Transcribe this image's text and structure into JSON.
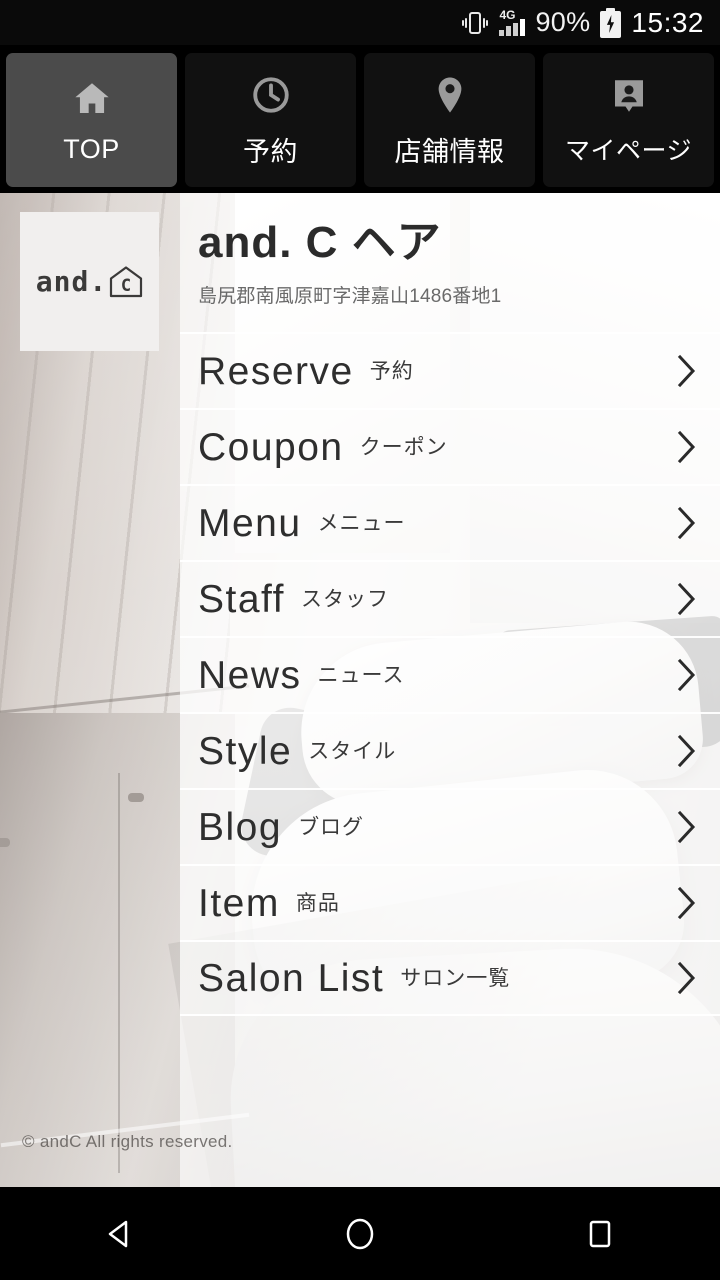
{
  "status_bar": {
    "vibrate_icon": "vibrate-icon",
    "network_type": "4G",
    "signal_icon": "signal-bars-icon",
    "battery_percent": "90%",
    "battery_icon": "battery-charging-icon",
    "time": "15:32"
  },
  "tabs": [
    {
      "label": "TOP",
      "icon": "home-icon",
      "active": true
    },
    {
      "label": "予約",
      "icon": "clock-icon",
      "active": false
    },
    {
      "label": "店舗情報",
      "icon": "map-pin-icon",
      "active": false
    },
    {
      "label": "マイページ",
      "icon": "person-badge-icon",
      "active": false
    }
  ],
  "logo": {
    "text": "and.",
    "mark_letter": "C",
    "icon": "house-outline-icon"
  },
  "salon": {
    "name": "and. C ヘア",
    "address": "島尻郡南風原町字津嘉山1486番地1"
  },
  "menu": [
    {
      "en": "Reserve",
      "ja": "予約",
      "icon": "chevron-right-icon"
    },
    {
      "en": "Coupon",
      "ja": "クーポン",
      "icon": "chevron-right-icon"
    },
    {
      "en": "Menu",
      "ja": "メニュー",
      "icon": "chevron-right-icon"
    },
    {
      "en": "Staff",
      "ja": "スタッフ",
      "icon": "chevron-right-icon"
    },
    {
      "en": "News",
      "ja": "ニュース",
      "icon": "chevron-right-icon"
    },
    {
      "en": "Style",
      "ja": "スタイル",
      "icon": "chevron-right-icon"
    },
    {
      "en": "Blog",
      "ja": "ブログ",
      "icon": "chevron-right-icon"
    },
    {
      "en": "Item",
      "ja": "商品",
      "icon": "chevron-right-icon"
    },
    {
      "en": "Salon List",
      "ja": "サロン一覧",
      "icon": "chevron-right-icon"
    }
  ],
  "footer": {
    "copyright": "© andC All rights reserved."
  },
  "nav_bar": {
    "back": "back-triangle-icon",
    "home": "home-circle-icon",
    "recents": "recents-square-icon"
  },
  "colors": {
    "status_bar_bg": "#0a0a0a",
    "tab_bg": "#111111",
    "tab_active_bg": "#4b4b4b",
    "panel_bg": "rgba(255,255,255,0.62)",
    "text_dark": "#2b2b2b",
    "text_muted": "#6a6a6a"
  }
}
